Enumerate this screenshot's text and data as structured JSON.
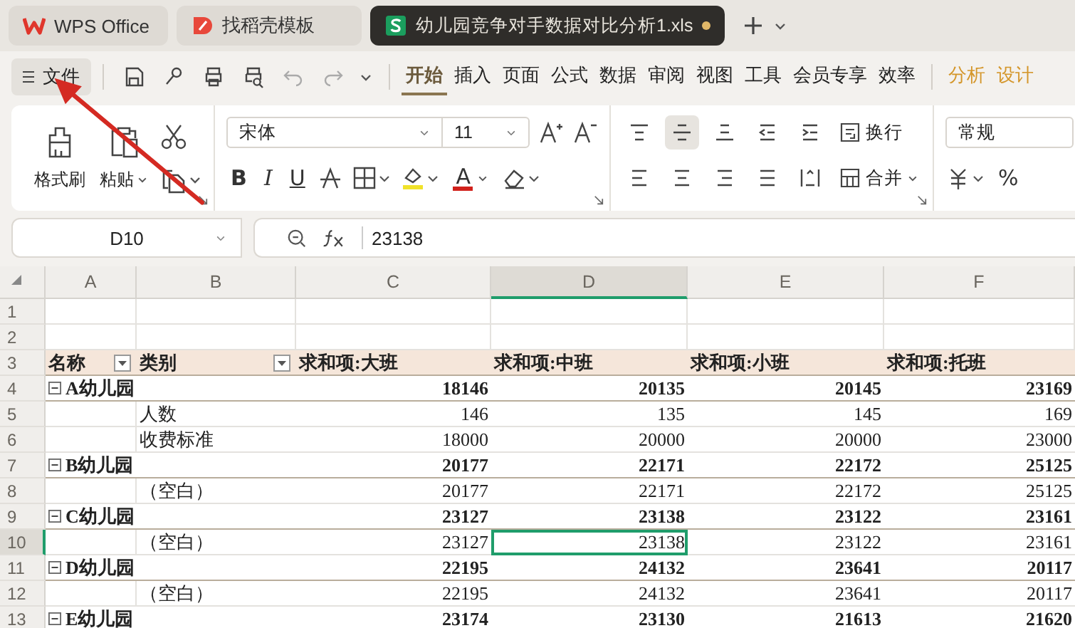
{
  "app_tabs": [
    {
      "kind": "wps",
      "label": "WPS Office",
      "selected": false
    },
    {
      "kind": "template",
      "label": "找稻壳模板",
      "selected": false
    },
    {
      "kind": "sheet",
      "label": "幼儿园竞争对手数据对比分析1.xls",
      "selected": true,
      "modified": true
    }
  ],
  "file_menu": {
    "label": "文件"
  },
  "menu_tabs": [
    {
      "label": "开始",
      "selected": true,
      "kind": "main"
    },
    {
      "label": "插入",
      "selected": false,
      "kind": "main"
    },
    {
      "label": "页面",
      "selected": false,
      "kind": "main"
    },
    {
      "label": "公式",
      "selected": false,
      "kind": "main"
    },
    {
      "label": "数据",
      "selected": false,
      "kind": "main"
    },
    {
      "label": "审阅",
      "selected": false,
      "kind": "main"
    },
    {
      "label": "视图",
      "selected": false,
      "kind": "main"
    },
    {
      "label": "工具",
      "selected": false,
      "kind": "main"
    },
    {
      "label": "会员专享",
      "selected": false,
      "kind": "main"
    },
    {
      "label": "效率",
      "selected": false,
      "kind": "main"
    },
    {
      "label": "分析",
      "selected": false,
      "kind": "context"
    },
    {
      "label": "设计",
      "selected": false,
      "kind": "context"
    }
  ],
  "ribbon": {
    "format_painter": "格式刷",
    "paste": "粘贴",
    "font_name": "宋体",
    "font_size": "11",
    "bold": "B",
    "italic": "I",
    "underline": "U",
    "font_color": "A",
    "align": [
      {
        "kind": "top",
        "selected": false
      },
      {
        "kind": "middle",
        "selected": true
      },
      {
        "kind": "bottom",
        "selected": false
      },
      {
        "kind": "outdent",
        "selected": false
      },
      {
        "kind": "indent",
        "selected": false
      }
    ],
    "wrap": "换行",
    "merge": "合并",
    "number_format": "常规",
    "percent": "%"
  },
  "name_box": "D10",
  "formula": "23138",
  "columns": [
    {
      "label": "A",
      "selected": false
    },
    {
      "label": "B",
      "selected": false
    },
    {
      "label": "C",
      "selected": false
    },
    {
      "label": "D",
      "selected": true
    },
    {
      "label": "E",
      "selected": false
    },
    {
      "label": "F",
      "selected": false
    }
  ],
  "rows": [
    {
      "number": "1",
      "selected": false,
      "kind": "empty"
    },
    {
      "number": "2",
      "selected": false,
      "kind": "empty"
    },
    {
      "number": "3",
      "selected": false,
      "kind": "header",
      "name": "名称",
      "category": "类别",
      "values": [
        "求和项:大班",
        "求和项:中班",
        "求和项:小班",
        "求和项:托班"
      ]
    },
    {
      "number": "4",
      "selected": false,
      "kind": "group",
      "expanded": true,
      "name": "A幼儿园",
      "values": [
        "18146",
        "20135",
        "20145",
        "23169"
      ]
    },
    {
      "number": "5",
      "selected": false,
      "kind": "item",
      "label": "人数",
      "values": [
        "146",
        "135",
        "145",
        "169"
      ]
    },
    {
      "number": "6",
      "selected": false,
      "kind": "item",
      "label": "收费标准",
      "values": [
        "18000",
        "20000",
        "20000",
        "23000"
      ]
    },
    {
      "number": "7",
      "selected": false,
      "kind": "group",
      "expanded": true,
      "name": "B幼儿园",
      "values": [
        "20177",
        "22171",
        "22172",
        "25125"
      ]
    },
    {
      "number": "8",
      "selected": false,
      "kind": "item",
      "label": "（空白）",
      "values": [
        "20177",
        "22171",
        "22172",
        "25125"
      ]
    },
    {
      "number": "9",
      "selected": false,
      "kind": "group",
      "expanded": true,
      "name": "C幼儿园",
      "values": [
        "23127",
        "23138",
        "23122",
        "23161"
      ]
    },
    {
      "number": "10",
      "selected": true,
      "kind": "item",
      "label": "（空白）",
      "values": [
        "23127",
        "23138",
        "23122",
        "23161"
      ]
    },
    {
      "number": "11",
      "selected": false,
      "kind": "group",
      "expanded": true,
      "name": "D幼儿园",
      "values": [
        "22195",
        "24132",
        "23641",
        "20117"
      ]
    },
    {
      "number": "12",
      "selected": false,
      "kind": "item",
      "label": "（空白）",
      "values": [
        "22195",
        "24132",
        "23641",
        "20117"
      ]
    },
    {
      "number": "13",
      "selected": false,
      "kind": "group",
      "expanded": true,
      "name": "E幼儿园",
      "values": [
        "23174",
        "23130",
        "21613",
        "21620"
      ]
    }
  ]
}
